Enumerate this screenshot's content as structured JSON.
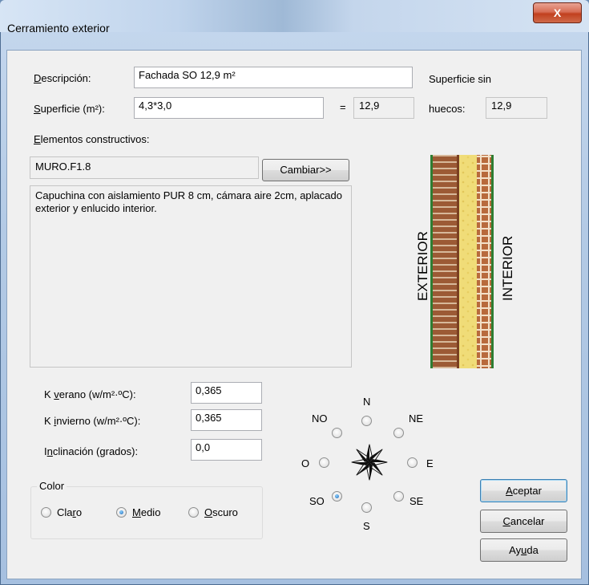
{
  "window": {
    "title": "Cerramiento exterior",
    "close_glyph": "X"
  },
  "form": {
    "descripcion": {
      "label": "Descripción:",
      "value": "Fachada SO 12,9 m²"
    },
    "superficie": {
      "label": "Superficie (m²):",
      "value": "4,3*3,0",
      "equals": "=",
      "result": "12,9"
    },
    "superficie_sin": {
      "label_line1": "Superficie sin",
      "label_line2": "huecos:",
      "value": "12,9"
    },
    "elementos": {
      "label": "Elementos constructivos:",
      "code": "MURO.F1.8",
      "change_button": "Cambiar>>",
      "description": "Capuchina con aislamiento PUR 8 cm, cámara aire 2cm, aplacado exterior y enlucido interior."
    },
    "k_verano": {
      "label": "K verano (w/m²·ºC):",
      "value": "0,365"
    },
    "k_invierno": {
      "label": "K invierno (w/m²·ºC):",
      "value": "0,365"
    },
    "inclinacion": {
      "label": "Inclinación (grados):",
      "value": "0,0"
    }
  },
  "wall_diagram": {
    "exterior_label": "EXTERIOR",
    "interior_label": "INTERIOR",
    "colors": {
      "brick": "#a0522d",
      "mortar": "#c79a7a",
      "insulation": "#f2e07a",
      "green_line": "#2e7d32"
    }
  },
  "color_group": {
    "title": "Color",
    "options": [
      {
        "label": "Claro",
        "selected": false
      },
      {
        "label": "Medio",
        "selected": true
      },
      {
        "label": "Oscuro",
        "selected": false
      }
    ]
  },
  "orientation": {
    "labels": {
      "N": "N",
      "NE": "NE",
      "E": "E",
      "SE": "SE",
      "S": "S",
      "SO": "SO",
      "O": "O",
      "NO": "NO"
    },
    "selected": "SO"
  },
  "buttons": {
    "aceptar": "Aceptar",
    "cancelar": "Cancelar",
    "ayuda": "Ayuda"
  }
}
